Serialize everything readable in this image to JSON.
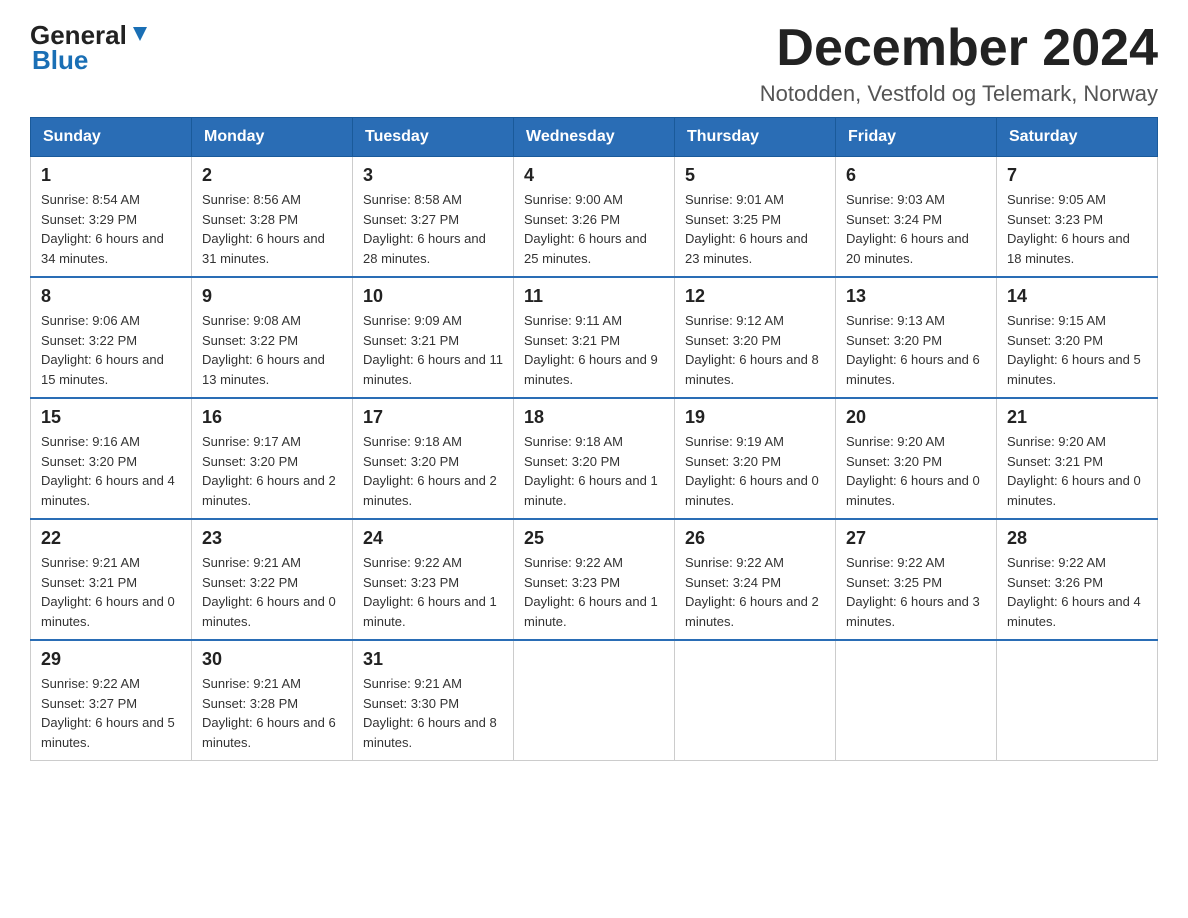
{
  "header": {
    "logo_general": "General",
    "logo_blue": "Blue",
    "month_title": "December 2024",
    "subtitle": "Notodden, Vestfold og Telemark, Norway"
  },
  "days_of_week": [
    "Sunday",
    "Monday",
    "Tuesday",
    "Wednesday",
    "Thursday",
    "Friday",
    "Saturday"
  ],
  "weeks": [
    [
      {
        "day": "1",
        "sunrise": "8:54 AM",
        "sunset": "3:29 PM",
        "daylight": "6 hours and 34 minutes."
      },
      {
        "day": "2",
        "sunrise": "8:56 AM",
        "sunset": "3:28 PM",
        "daylight": "6 hours and 31 minutes."
      },
      {
        "day": "3",
        "sunrise": "8:58 AM",
        "sunset": "3:27 PM",
        "daylight": "6 hours and 28 minutes."
      },
      {
        "day": "4",
        "sunrise": "9:00 AM",
        "sunset": "3:26 PM",
        "daylight": "6 hours and 25 minutes."
      },
      {
        "day": "5",
        "sunrise": "9:01 AM",
        "sunset": "3:25 PM",
        "daylight": "6 hours and 23 minutes."
      },
      {
        "day": "6",
        "sunrise": "9:03 AM",
        "sunset": "3:24 PM",
        "daylight": "6 hours and 20 minutes."
      },
      {
        "day": "7",
        "sunrise": "9:05 AM",
        "sunset": "3:23 PM",
        "daylight": "6 hours and 18 minutes."
      }
    ],
    [
      {
        "day": "8",
        "sunrise": "9:06 AM",
        "sunset": "3:22 PM",
        "daylight": "6 hours and 15 minutes."
      },
      {
        "day": "9",
        "sunrise": "9:08 AM",
        "sunset": "3:22 PM",
        "daylight": "6 hours and 13 minutes."
      },
      {
        "day": "10",
        "sunrise": "9:09 AM",
        "sunset": "3:21 PM",
        "daylight": "6 hours and 11 minutes."
      },
      {
        "day": "11",
        "sunrise": "9:11 AM",
        "sunset": "3:21 PM",
        "daylight": "6 hours and 9 minutes."
      },
      {
        "day": "12",
        "sunrise": "9:12 AM",
        "sunset": "3:20 PM",
        "daylight": "6 hours and 8 minutes."
      },
      {
        "day": "13",
        "sunrise": "9:13 AM",
        "sunset": "3:20 PM",
        "daylight": "6 hours and 6 minutes."
      },
      {
        "day": "14",
        "sunrise": "9:15 AM",
        "sunset": "3:20 PM",
        "daylight": "6 hours and 5 minutes."
      }
    ],
    [
      {
        "day": "15",
        "sunrise": "9:16 AM",
        "sunset": "3:20 PM",
        "daylight": "6 hours and 4 minutes."
      },
      {
        "day": "16",
        "sunrise": "9:17 AM",
        "sunset": "3:20 PM",
        "daylight": "6 hours and 2 minutes."
      },
      {
        "day": "17",
        "sunrise": "9:18 AM",
        "sunset": "3:20 PM",
        "daylight": "6 hours and 2 minutes."
      },
      {
        "day": "18",
        "sunrise": "9:18 AM",
        "sunset": "3:20 PM",
        "daylight": "6 hours and 1 minute."
      },
      {
        "day": "19",
        "sunrise": "9:19 AM",
        "sunset": "3:20 PM",
        "daylight": "6 hours and 0 minutes."
      },
      {
        "day": "20",
        "sunrise": "9:20 AM",
        "sunset": "3:20 PM",
        "daylight": "6 hours and 0 minutes."
      },
      {
        "day": "21",
        "sunrise": "9:20 AM",
        "sunset": "3:21 PM",
        "daylight": "6 hours and 0 minutes."
      }
    ],
    [
      {
        "day": "22",
        "sunrise": "9:21 AM",
        "sunset": "3:21 PM",
        "daylight": "6 hours and 0 minutes."
      },
      {
        "day": "23",
        "sunrise": "9:21 AM",
        "sunset": "3:22 PM",
        "daylight": "6 hours and 0 minutes."
      },
      {
        "day": "24",
        "sunrise": "9:22 AM",
        "sunset": "3:23 PM",
        "daylight": "6 hours and 1 minute."
      },
      {
        "day": "25",
        "sunrise": "9:22 AM",
        "sunset": "3:23 PM",
        "daylight": "6 hours and 1 minute."
      },
      {
        "day": "26",
        "sunrise": "9:22 AM",
        "sunset": "3:24 PM",
        "daylight": "6 hours and 2 minutes."
      },
      {
        "day": "27",
        "sunrise": "9:22 AM",
        "sunset": "3:25 PM",
        "daylight": "6 hours and 3 minutes."
      },
      {
        "day": "28",
        "sunrise": "9:22 AM",
        "sunset": "3:26 PM",
        "daylight": "6 hours and 4 minutes."
      }
    ],
    [
      {
        "day": "29",
        "sunrise": "9:22 AM",
        "sunset": "3:27 PM",
        "daylight": "6 hours and 5 minutes."
      },
      {
        "day": "30",
        "sunrise": "9:21 AM",
        "sunset": "3:28 PM",
        "daylight": "6 hours and 6 minutes."
      },
      {
        "day": "31",
        "sunrise": "9:21 AM",
        "sunset": "3:30 PM",
        "daylight": "6 hours and 8 minutes."
      },
      null,
      null,
      null,
      null
    ]
  ]
}
